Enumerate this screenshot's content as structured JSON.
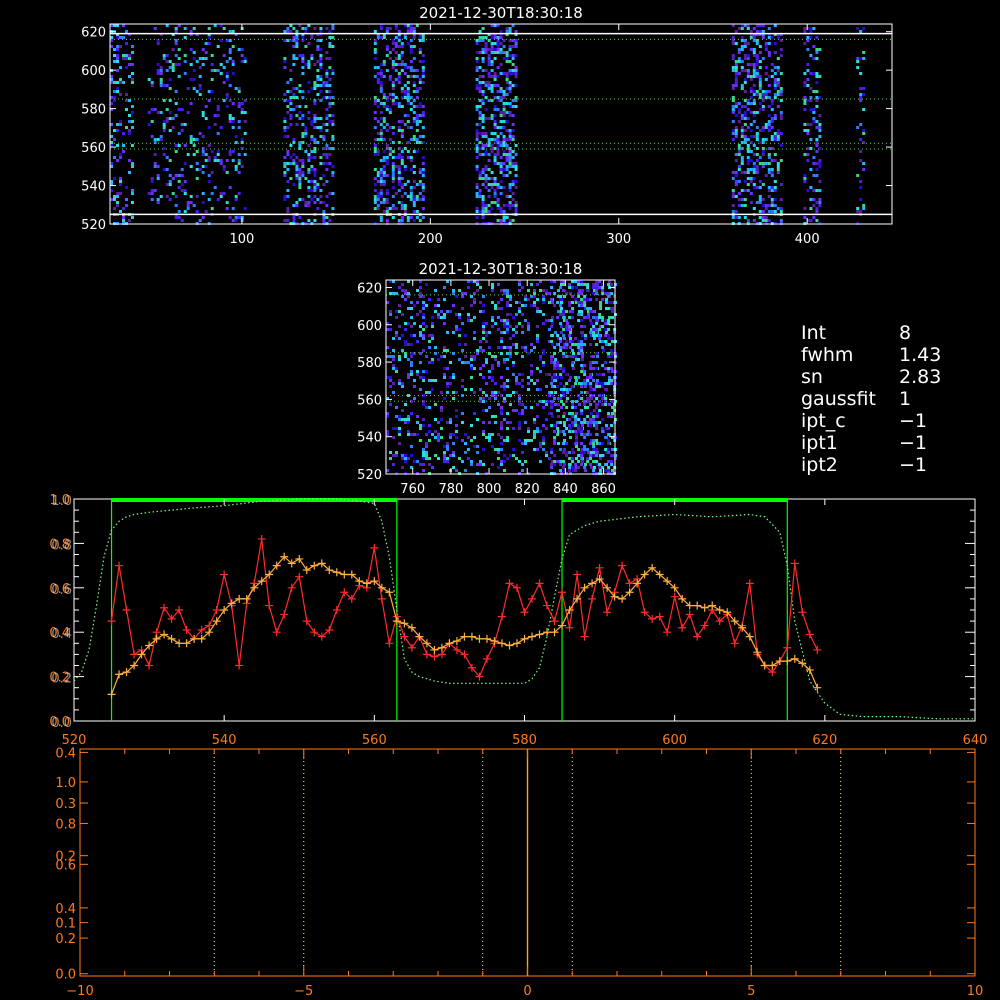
{
  "charts": [
    {
      "type": "heatmap",
      "title": "2021-12-30T18:30:18",
      "xlim": [
        30,
        445
      ],
      "ylim": [
        520,
        624
      ],
      "xticks": [
        100,
        200,
        300,
        400
      ],
      "yticks": [
        520,
        540,
        560,
        580,
        600,
        620
      ],
      "solid_hlines": [
        525,
        619
      ],
      "dotted_hlines": [
        616,
        585,
        562,
        559
      ],
      "pixel_density": 0.55,
      "seed": 11,
      "columns": [
        [
          30,
          42,
          0.55
        ],
        [
          50,
          102,
          0.32
        ],
        [
          122,
          148,
          0.6
        ],
        [
          170,
          196,
          0.75
        ],
        [
          224,
          246,
          0.9
        ],
        [
          360,
          386,
          0.75
        ],
        [
          398,
          406,
          0.6
        ],
        [
          426,
          430,
          0.4
        ]
      ],
      "palette": [
        "#2a0bd0",
        "#4a1ff0",
        "#6a2fff",
        "#2f7dff",
        "#22b8ff",
        "#29e0e0",
        "#39d890",
        "#5a20a0"
      ]
    },
    {
      "type": "heatmap",
      "title": "2021-12-30T18:30:18",
      "xlim": [
        746,
        866
      ],
      "ylim": [
        520,
        624
      ],
      "xticks": [
        760,
        780,
        800,
        820,
        840,
        860
      ],
      "yticks": [
        520,
        540,
        560,
        580,
        600,
        620
      ],
      "dotted_hlines": [
        616,
        585,
        562,
        559
      ],
      "pixel_density": 0.42,
      "seed": 29,
      "columns": [
        [
          746,
          866,
          0.42
        ],
        [
          832,
          866,
          0.7
        ]
      ],
      "palette": [
        "#2a0bd0",
        "#4a1ff0",
        "#6a2fff",
        "#2f7dff",
        "#22b8ff",
        "#29e0e0",
        "#39d890",
        "#5a20a0"
      ]
    },
    {
      "type": "line",
      "xlim": [
        520,
        640
      ],
      "ylim": [
        0,
        1.0
      ],
      "xticks": [
        520,
        540,
        560,
        580,
        600,
        620,
        640
      ],
      "yticks_left": [
        0.0,
        0.2,
        0.4,
        0.6,
        0.8,
        1.0
      ],
      "overlap_yticks": [
        "1.0",
        "0.8",
        "0.6",
        "0.4",
        "0.2",
        "0.0"
      ],
      "vlines": [
        525,
        563,
        585,
        615
      ],
      "bars": [
        [
          525,
          563,
          1.0
        ],
        [
          585,
          615,
          1.0
        ]
      ],
      "series": [
        {
          "style": "dotted",
          "color": "#7cff7c",
          "x": [
            520,
            521,
            522,
            523,
            524,
            525,
            526,
            527,
            528,
            530,
            533,
            536,
            540,
            545,
            550,
            555,
            558,
            560,
            561,
            562,
            563,
            564,
            565,
            566,
            568,
            570,
            575,
            580,
            581,
            582,
            583,
            584,
            585,
            586,
            588,
            590,
            595,
            600,
            605,
            610,
            612,
            614,
            615,
            616,
            618,
            620,
            622,
            625,
            630,
            635,
            640
          ],
          "y": [
            0.18,
            0.22,
            0.32,
            0.52,
            0.74,
            0.86,
            0.9,
            0.92,
            0.93,
            0.94,
            0.95,
            0.96,
            0.97,
            0.99,
            1.0,
            1.0,
            0.99,
            0.98,
            0.9,
            0.74,
            0.5,
            0.28,
            0.22,
            0.2,
            0.18,
            0.17,
            0.17,
            0.17,
            0.19,
            0.24,
            0.38,
            0.56,
            0.73,
            0.84,
            0.88,
            0.9,
            0.92,
            0.93,
            0.92,
            0.93,
            0.92,
            0.85,
            0.7,
            0.45,
            0.18,
            0.08,
            0.03,
            0.02,
            0.02,
            0.01,
            0.01
          ]
        },
        {
          "style": "line+plus",
          "color": "#ff2a2a",
          "x": [
            525,
            526,
            527,
            528,
            529,
            530,
            531,
            532,
            533,
            534,
            535,
            536,
            537,
            538,
            539,
            540,
            541,
            542,
            543,
            544,
            545,
            546,
            547,
            548,
            549,
            550,
            551,
            552,
            553,
            554,
            555,
            556,
            557,
            558,
            559,
            560,
            561,
            562,
            563,
            564,
            565,
            566,
            567,
            568,
            569,
            570,
            571,
            572,
            573,
            574,
            575,
            576,
            577,
            578,
            579,
            580,
            581,
            582,
            583,
            584,
            585,
            586,
            587,
            588,
            589,
            590,
            591,
            592,
            593,
            594,
            595,
            596,
            597,
            598,
            599,
            600,
            601,
            602,
            603,
            604,
            605,
            606,
            607,
            608,
            609,
            610,
            611,
            612,
            613,
            614,
            615,
            616,
            617,
            618,
            619
          ],
          "y": [
            0.45,
            0.7,
            0.5,
            0.3,
            0.32,
            0.25,
            0.4,
            0.51,
            0.46,
            0.5,
            0.41,
            0.37,
            0.41,
            0.43,
            0.5,
            0.66,
            0.52,
            0.25,
            0.53,
            0.62,
            0.82,
            0.52,
            0.4,
            0.48,
            0.6,
            0.65,
            0.45,
            0.4,
            0.38,
            0.41,
            0.5,
            0.58,
            0.55,
            0.61,
            0.6,
            0.78,
            0.55,
            0.35,
            0.47,
            0.38,
            0.33,
            0.38,
            0.3,
            0.29,
            0.3,
            0.35,
            0.32,
            0.3,
            0.24,
            0.2,
            0.28,
            0.35,
            0.47,
            0.62,
            0.6,
            0.49,
            0.55,
            0.62,
            0.52,
            0.45,
            0.58,
            0.42,
            0.66,
            0.38,
            0.55,
            0.69,
            0.49,
            0.58,
            0.7,
            0.62,
            0.64,
            0.49,
            0.46,
            0.47,
            0.4,
            0.56,
            0.42,
            0.48,
            0.38,
            0.43,
            0.5,
            0.45,
            0.48,
            0.35,
            0.43,
            0.62,
            0.3,
            0.25,
            0.22,
            0.27,
            0.33,
            0.71,
            0.49,
            0.39,
            0.32
          ]
        },
        {
          "style": "line+plus",
          "color": "#ffb040",
          "x": [
            525,
            526,
            527,
            528,
            529,
            530,
            531,
            532,
            533,
            534,
            535,
            536,
            537,
            538,
            539,
            540,
            541,
            542,
            543,
            544,
            545,
            546,
            547,
            548,
            549,
            550,
            551,
            552,
            553,
            554,
            555,
            556,
            557,
            558,
            559,
            560,
            561,
            562,
            563,
            564,
            565,
            566,
            567,
            568,
            569,
            570,
            571,
            572,
            573,
            574,
            575,
            576,
            577,
            578,
            579,
            580,
            581,
            582,
            583,
            584,
            585,
            586,
            587,
            588,
            589,
            590,
            591,
            592,
            593,
            594,
            595,
            596,
            597,
            598,
            599,
            600,
            601,
            602,
            603,
            604,
            605,
            606,
            607,
            608,
            609,
            610,
            611,
            612,
            613,
            614,
            615,
            616,
            617,
            618,
            619
          ],
          "y": [
            0.12,
            0.21,
            0.22,
            0.25,
            0.3,
            0.34,
            0.37,
            0.39,
            0.37,
            0.35,
            0.35,
            0.37,
            0.37,
            0.4,
            0.45,
            0.5,
            0.53,
            0.55,
            0.55,
            0.6,
            0.63,
            0.66,
            0.7,
            0.74,
            0.71,
            0.73,
            0.68,
            0.7,
            0.71,
            0.68,
            0.67,
            0.66,
            0.66,
            0.63,
            0.62,
            0.63,
            0.6,
            0.58,
            0.45,
            0.44,
            0.42,
            0.38,
            0.35,
            0.32,
            0.33,
            0.35,
            0.36,
            0.38,
            0.38,
            0.37,
            0.37,
            0.36,
            0.35,
            0.34,
            0.35,
            0.37,
            0.38,
            0.39,
            0.4,
            0.4,
            0.43,
            0.5,
            0.55,
            0.6,
            0.62,
            0.64,
            0.6,
            0.56,
            0.55,
            0.58,
            0.62,
            0.66,
            0.69,
            0.66,
            0.63,
            0.6,
            0.55,
            0.52,
            0.52,
            0.51,
            0.52,
            0.5,
            0.49,
            0.45,
            0.42,
            0.38,
            0.31,
            0.25,
            0.25,
            0.27,
            0.27,
            0.28,
            0.26,
            0.23,
            0.15
          ]
        }
      ]
    },
    {
      "type": "line",
      "xlim": [
        -10,
        10
      ],
      "xticks": [
        -10,
        -5,
        0,
        5,
        10
      ],
      "left_tick_labels": [
        {
          "t": "0.4",
          "f": 0.015
        },
        {
          "t": "1.0",
          "f": 0.145
        },
        {
          "t": "0.3",
          "f": 0.238
        },
        {
          "t": "0.8",
          "f": 0.328
        },
        {
          "t": "0.2",
          "f": 0.47
        },
        {
          "t": "0.6",
          "f": 0.508
        },
        {
          "t": "0.4",
          "f": 0.7
        },
        {
          "t": "0.1",
          "f": 0.765
        },
        {
          "t": "0.2",
          "f": 0.833
        },
        {
          "t": "0.0",
          "f": 0.99
        }
      ],
      "dotted_vlines": [
        -7,
        -5,
        -1,
        1,
        5,
        7
      ],
      "solid_vlines": [
        0
      ]
    }
  ],
  "info": [
    {
      "key": "Int",
      "value": "8"
    },
    {
      "key": "fwhm",
      "value": "1.43"
    },
    {
      "key": "sn",
      "value": "2.83"
    },
    {
      "key": "gaussfit",
      "value": "1"
    },
    {
      "key": "ipt_c",
      "value": "−1"
    },
    {
      "key": "ipt1",
      "value": "−1"
    },
    {
      "key": "ipt2",
      "value": "−1"
    }
  ],
  "colors": {
    "axis": "#ffffff",
    "spectrum_axis": "#ff7a1a",
    "green": "#00ff00",
    "red": "#ff2a2a",
    "orange": "#ffb040"
  }
}
